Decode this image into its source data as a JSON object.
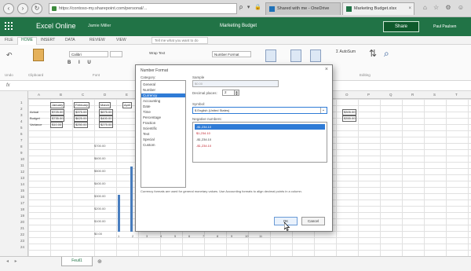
{
  "browser": {
    "url": "https://contoso-my.sharepoint.com/personal/...",
    "tabs": [
      {
        "label": "Shared with me - OneDrive"
      },
      {
        "label": "Marketing Budget.xlsx"
      }
    ],
    "back_label": "‹",
    "forward_label": "›",
    "refresh_label": "↻",
    "addr_tools": "ρ ▾ 🔒 C",
    "chrome_icons": "⌂ ☆ ⚙ ☺"
  },
  "app": {
    "name": "Excel Online",
    "user": "Jamie Miller",
    "doc_title": "Marketing Budget",
    "share_label": "Share",
    "person": "Paul Paulsen"
  },
  "ribbon": {
    "tabs": [
      "FILE",
      "HOME",
      "INSERT",
      "DATA",
      "REVIEW",
      "VIEW"
    ],
    "tell_me": "Tell me what you want to do",
    "font_name": "Calibri",
    "format_buttons": "B I U",
    "wrap_label": "Wrap Text",
    "number_format": "Number Format",
    "autosum_label": "AutoSum",
    "sort_label": "Sort",
    "find_label": "Find",
    "groups": [
      "Undo",
      "Clipboard",
      "Font",
      "Alignment",
      "Number",
      "Tables",
      "Cells",
      "Editing"
    ]
  },
  "formula_bar": {
    "fx": "fx"
  },
  "sheet": {
    "columns": [
      "A",
      "B",
      "C",
      "D",
      "E",
      "F",
      "G",
      "H",
      "I",
      "J",
      "K",
      "L",
      "M",
      "N",
      "O",
      "P",
      "Q",
      "R",
      "S",
      "T"
    ],
    "rows": [
      "1",
      "2",
      "3",
      "4",
      "5",
      "6",
      "7",
      "8",
      "9",
      "10",
      "11",
      "12",
      "13",
      "14",
      "15",
      "16",
      "17",
      "18",
      "19",
      "20",
      "21",
      "22",
      "23",
      "24"
    ],
    "header_cells": [
      "January",
      "February",
      "March",
      "April"
    ],
    "row_labels": [
      "Actual",
      "Budget",
      "Variance"
    ],
    "actual_values": [
      "$725.00",
      "$375.00",
      "$675.00"
    ],
    "budget_values": [
      "$735.00",
      "$625.00",
      "$400.00"
    ],
    "variance_values": [
      "$10.00",
      "$250.00",
      "$275.00"
    ],
    "right_values": [
      "$305.00",
      "$355.00"
    ],
    "chart_axis": [
      "$700.00",
      "$600.00",
      "$500.00",
      "$400.00",
      "$300.00",
      "$200.00",
      "$100.00",
      "$0.00"
    ],
    "chart_x": [
      "1",
      "2",
      "3",
      "4",
      "5",
      "6",
      "7",
      "8",
      "9",
      "10",
      "11"
    ],
    "bar_levels": [
      0.42,
      0.74
    ],
    "tab_name": "Feuil1"
  },
  "dialog": {
    "title": "Number Format",
    "category_label": "Category:",
    "categories": [
      "General",
      "Number",
      "Currency",
      "Accounting",
      "Date",
      "Time",
      "Percentage",
      "Fraction",
      "Scientific",
      "Text",
      "Special",
      "Custom"
    ],
    "selected_category": "Currency",
    "sample_label": "Sample",
    "sample_value": "$0.00",
    "decimal_label": "Decimal places:",
    "decimal_value": "2",
    "symbol_label": "Symbol:",
    "symbol_value": "$ English (United States)",
    "negative_label": "Negative numbers:",
    "negative_items": [
      {
        "text": "-$1,234.10",
        "style": "selected"
      },
      {
        "text": "$1,234.10",
        "style": "red"
      },
      {
        "text": "-$1,234.10",
        "style": "normal"
      },
      {
        "text": "-$1,234.10",
        "style": "red"
      }
    ],
    "description": "Currency formats are used for general monetary values. Use Accounting formats to align decimal points in a column.",
    "ok_label": "OK",
    "cancel_label": "Cancel"
  }
}
